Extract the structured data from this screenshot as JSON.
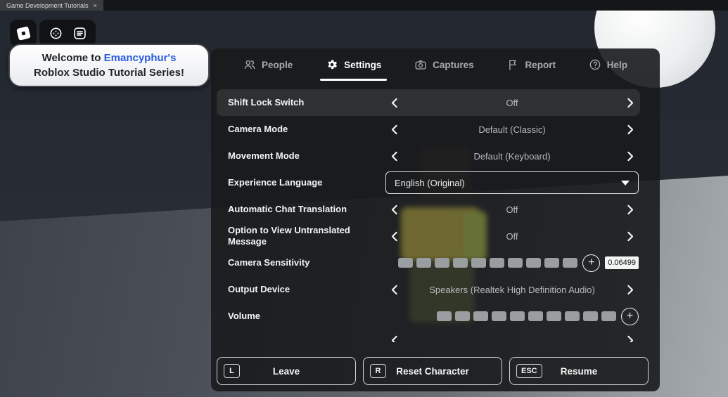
{
  "browser_tab": {
    "title": "Game Development Tutorials",
    "close_glyph": "×"
  },
  "colors": {
    "accent_name": "#2a5ce0",
    "panel_bg": "#1a1c1e",
    "highlight_row": "#2e3032"
  },
  "hud": {
    "icons": [
      "roblox-logo-icon",
      "quick-menu-icon",
      "playerlist-icon"
    ]
  },
  "banner": {
    "line1_prefix": "Welcome to ",
    "line1_name": "Emancyphur's",
    "line2": "Roblox Studio Tutorial Series!"
  },
  "menu": {
    "tabs": [
      {
        "icon": "people-icon",
        "label": "People"
      },
      {
        "icon": "gear-icon",
        "label": "Settings",
        "selected": true
      },
      {
        "icon": "captures-icon",
        "label": "Captures"
      },
      {
        "icon": "report-icon",
        "label": "Report"
      },
      {
        "icon": "help-icon",
        "label": "Help"
      }
    ],
    "control_icons": [
      "chevron-left-icon",
      "chevron-right-icon",
      "plus-icon",
      "caret-down-icon"
    ],
    "rows": [
      {
        "type": "stepper",
        "label": "Shift Lock Switch",
        "value": "Off",
        "highlighted": true
      },
      {
        "type": "stepper",
        "label": "Camera Mode",
        "value": "Default (Classic)"
      },
      {
        "type": "stepper",
        "label": "Movement Mode",
        "value": "Default (Keyboard)"
      },
      {
        "type": "dropdown",
        "label": "Experience Language",
        "value": "English (Original)"
      },
      {
        "type": "stepper",
        "label": "Automatic Chat Translation",
        "value": "Off"
      },
      {
        "type": "stepper",
        "label": "Option to View Untranslated Message",
        "value": "Off"
      },
      {
        "type": "slider",
        "label": "Camera Sensitivity",
        "segments": 10,
        "filled": 0,
        "value": "0.06499",
        "has_value_box": true
      },
      {
        "type": "stepper",
        "label": "Output Device",
        "value": "Speakers (Realtek High Definition Audio)"
      },
      {
        "type": "slider",
        "label": "Volume",
        "segments": 10,
        "filled": 0
      },
      {
        "type": "partial"
      }
    ],
    "buttons": [
      {
        "key": "L",
        "label": "Leave"
      },
      {
        "key": "R",
        "label": "Reset Character"
      },
      {
        "key": "ESC",
        "label": "Resume"
      }
    ]
  }
}
